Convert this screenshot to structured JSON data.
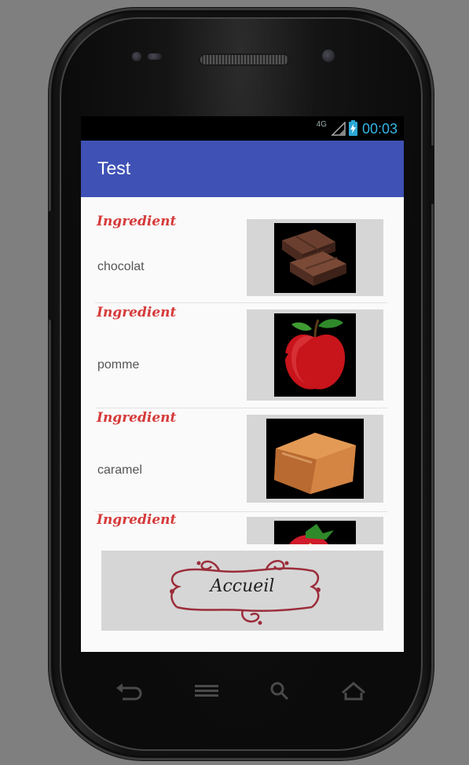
{
  "status_bar": {
    "network": "4G",
    "time": "00:03"
  },
  "app_bar": {
    "title": "Test"
  },
  "ingredients": [
    {
      "label": "Ingredient",
      "name": "chocolat",
      "image_icon": "chocolate-bar-image"
    },
    {
      "label": "Ingredient",
      "name": "pomme",
      "image_icon": "apple-image"
    },
    {
      "label": "Ingredient",
      "name": "caramel",
      "image_icon": "caramel-image"
    },
    {
      "label": "Ingredient",
      "name": "",
      "image_icon": "strawberry-image"
    }
  ],
  "home_button": {
    "label": "Accueil"
  },
  "nav_bar": {
    "icons": [
      "back-icon",
      "menu-icon",
      "search-icon",
      "home-icon"
    ]
  },
  "colors": {
    "app_bar": "#3f51b5",
    "ingredient_label": "#d63a3a",
    "clock": "#33b5e5",
    "frame_ornament": "#9b2d3a"
  }
}
